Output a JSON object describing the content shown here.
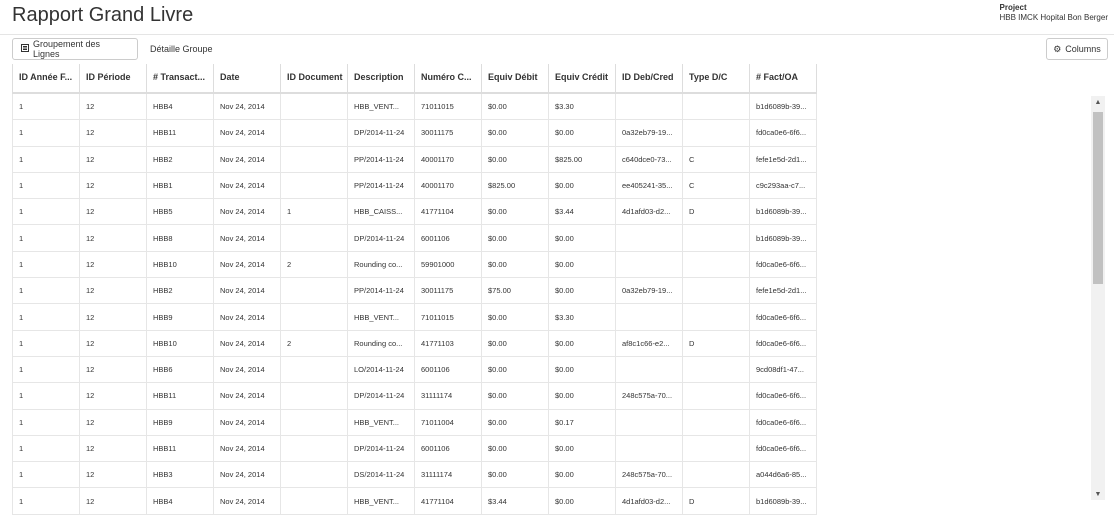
{
  "header": {
    "title": "Rapport Grand Livre",
    "project_label": "Project",
    "project_value": "HBB IMCK Hopital Bon Berger"
  },
  "toolbar": {
    "group_icon": "list-icon",
    "group_label": "Groupement des Lignes",
    "detail_label": "Détaille Groupe",
    "columns_icon": "gear-icon",
    "columns_label": "Columns"
  },
  "table": {
    "columns": [
      "ID Année F...",
      "ID Période",
      "# Transact...",
      "Date",
      "ID Document",
      "Description",
      "Numéro C...",
      "Equiv Débit",
      "Equiv Crédit",
      "ID Deb/Cred",
      "Type D/C",
      "# Fact/OA"
    ],
    "rows": [
      [
        "1",
        "12",
        "HBB4",
        "Nov 24, 2014",
        "",
        "HBB_VENT...",
        "71011015",
        "$0.00",
        "$3.30",
        "",
        "",
        "b1d6089b-39..."
      ],
      [
        "1",
        "12",
        "HBB11",
        "Nov 24, 2014",
        "",
        "DP/2014-11-24",
        "30011175",
        "$0.00",
        "$0.00",
        "0a32eb79-19...",
        "",
        "fd0ca0e6-6f6..."
      ],
      [
        "1",
        "12",
        "HBB2",
        "Nov 24, 2014",
        "",
        "PP/2014-11-24",
        "40001170",
        "$0.00",
        "$825.00",
        "c640dce0-73...",
        "C",
        "fefe1e5d-2d1..."
      ],
      [
        "1",
        "12",
        "HBB1",
        "Nov 24, 2014",
        "",
        "PP/2014-11-24",
        "40001170",
        "$825.00",
        "$0.00",
        "ee405241-35...",
        "C",
        "c9c293aa-c7..."
      ],
      [
        "1",
        "12",
        "HBB5",
        "Nov 24, 2014",
        "1",
        "HBB_CAISS...",
        "41771104",
        "$0.00",
        "$3.44",
        "4d1afd03-d2...",
        "D",
        "b1d6089b-39..."
      ],
      [
        "1",
        "12",
        "HBB8",
        "Nov 24, 2014",
        "",
        "DP/2014-11-24",
        "6001106",
        "$0.00",
        "$0.00",
        "",
        "",
        "b1d6089b-39..."
      ],
      [
        "1",
        "12",
        "HBB10",
        "Nov 24, 2014",
        "2",
        "Rounding co...",
        "59901000",
        "$0.00",
        "$0.00",
        "",
        "",
        "fd0ca0e6-6f6..."
      ],
      [
        "1",
        "12",
        "HBB2",
        "Nov 24, 2014",
        "",
        "PP/2014-11-24",
        "30011175",
        "$75.00",
        "$0.00",
        "0a32eb79-19...",
        "",
        "fefe1e5d-2d1..."
      ],
      [
        "1",
        "12",
        "HBB9",
        "Nov 24, 2014",
        "",
        "HBB_VENT...",
        "71011015",
        "$0.00",
        "$3.30",
        "",
        "",
        "fd0ca0e6-6f6..."
      ],
      [
        "1",
        "12",
        "HBB10",
        "Nov 24, 2014",
        "2",
        "Rounding co...",
        "41771103",
        "$0.00",
        "$0.00",
        "af8c1c66-e2...",
        "D",
        "fd0ca0e6-6f6..."
      ],
      [
        "1",
        "12",
        "HBB6",
        "Nov 24, 2014",
        "",
        "LO/2014-11-24",
        "6001106",
        "$0.00",
        "$0.00",
        "",
        "",
        "9cd08df1-47..."
      ],
      [
        "1",
        "12",
        "HBB11",
        "Nov 24, 2014",
        "",
        "DP/2014-11-24",
        "31111174",
        "$0.00",
        "$0.00",
        "248c575a-70...",
        "",
        "fd0ca0e6-6f6..."
      ],
      [
        "1",
        "12",
        "HBB9",
        "Nov 24, 2014",
        "",
        "HBB_VENT...",
        "71011004",
        "$0.00",
        "$0.17",
        "",
        "",
        "fd0ca0e6-6f6..."
      ],
      [
        "1",
        "12",
        "HBB11",
        "Nov 24, 2014",
        "",
        "DP/2014-11-24",
        "6001106",
        "$0.00",
        "$0.00",
        "",
        "",
        "fd0ca0e6-6f6..."
      ],
      [
        "1",
        "12",
        "HBB3",
        "Nov 24, 2014",
        "",
        "DS/2014-11-24",
        "31111174",
        "$0.00",
        "$0.00",
        "248c575a-70...",
        "",
        "a044d6a6-85..."
      ],
      [
        "1",
        "12",
        "HBB4",
        "Nov 24, 2014",
        "",
        "HBB_VENT...",
        "41771104",
        "$3.44",
        "$0.00",
        "4d1afd03-d2...",
        "D",
        "b1d6089b-39..."
      ]
    ]
  },
  "scrollbar": {
    "up_icon": "arrow-up-icon",
    "down_icon": "arrow-down-icon"
  }
}
